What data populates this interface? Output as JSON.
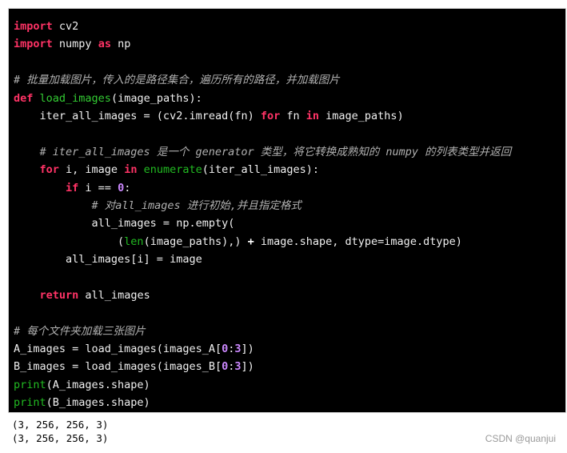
{
  "code": {
    "lines": [
      [
        {
          "t": "import",
          "c": "kw"
        },
        {
          "t": " cv2",
          "c": "tx"
        }
      ],
      [
        {
          "t": "import",
          "c": "kw"
        },
        {
          "t": " numpy ",
          "c": "tx"
        },
        {
          "t": "as",
          "c": "kw"
        },
        {
          "t": " np",
          "c": "tx"
        }
      ],
      [],
      [
        {
          "t": "# 批量加载图片，传入的是路径集合，遍历所有的路径，并加载图片",
          "c": "cm"
        }
      ],
      [
        {
          "t": "def",
          "c": "kw"
        },
        {
          "t": " ",
          "c": "tx"
        },
        {
          "t": "load_images",
          "c": "fn"
        },
        {
          "t": "(image_paths):",
          "c": "tx"
        }
      ],
      [
        {
          "t": "    iter_all_images = (cv2.imread(fn) ",
          "c": "tx"
        },
        {
          "t": "for",
          "c": "kw"
        },
        {
          "t": " fn ",
          "c": "tx"
        },
        {
          "t": "in",
          "c": "kw"
        },
        {
          "t": " image_paths)",
          "c": "tx"
        }
      ],
      [],
      [
        {
          "t": "    ",
          "c": "tx"
        },
        {
          "t": "# iter_all_images 是一个 generator 类型，将它转换成熟知的 numpy 的列表类型并返回",
          "c": "cm"
        }
      ],
      [
        {
          "t": "    ",
          "c": "tx"
        },
        {
          "t": "for",
          "c": "kw"
        },
        {
          "t": " i, image ",
          "c": "tx"
        },
        {
          "t": "in",
          "c": "kw"
        },
        {
          "t": " ",
          "c": "tx"
        },
        {
          "t": "enumerate",
          "c": "bi"
        },
        {
          "t": "(iter_all_images):",
          "c": "tx"
        }
      ],
      [
        {
          "t": "        ",
          "c": "tx"
        },
        {
          "t": "if",
          "c": "kw"
        },
        {
          "t": " i == ",
          "c": "tx"
        },
        {
          "t": "0",
          "c": "num"
        },
        {
          "t": ":",
          "c": "tx"
        }
      ],
      [
        {
          "t": "            ",
          "c": "tx"
        },
        {
          "t": "# 对all_images 进行初始,并且指定格式",
          "c": "cm"
        }
      ],
      [
        {
          "t": "            all_images = np.empty(",
          "c": "tx"
        }
      ],
      [
        {
          "t": "                (",
          "c": "tx"
        },
        {
          "t": "len",
          "c": "bi"
        },
        {
          "t": "(image_paths),) ",
          "c": "tx"
        },
        {
          "t": "+",
          "c": "op"
        },
        {
          "t": " image.shape, dtype=image.dtype)",
          "c": "tx"
        }
      ],
      [
        {
          "t": "        all_images[i] = image",
          "c": "tx"
        }
      ],
      [],
      [
        {
          "t": "    ",
          "c": "tx"
        },
        {
          "t": "return",
          "c": "kw"
        },
        {
          "t": " all_images",
          "c": "tx"
        }
      ],
      [],
      [
        {
          "t": "# 每个文件夹加载三张图片",
          "c": "cm"
        }
      ],
      [
        {
          "t": "A_images = load_images(images_A[",
          "c": "tx"
        },
        {
          "t": "0",
          "c": "num"
        },
        {
          "t": ":",
          "c": "tx"
        },
        {
          "t": "3",
          "c": "num"
        },
        {
          "t": "])",
          "c": "tx"
        }
      ],
      [
        {
          "t": "B_images = load_images(images_B[",
          "c": "tx"
        },
        {
          "t": "0",
          "c": "num"
        },
        {
          "t": ":",
          "c": "tx"
        },
        {
          "t": "3",
          "c": "num"
        },
        {
          "t": "])",
          "c": "tx"
        }
      ],
      [
        {
          "t": "print",
          "c": "bi"
        },
        {
          "t": "(A_images.shape)",
          "c": "tx"
        }
      ],
      [
        {
          "t": "print",
          "c": "bi"
        },
        {
          "t": "(B_images.shape)",
          "c": "tx"
        }
      ]
    ]
  },
  "output": {
    "lines": [
      "(3, 256, 256, 3)",
      "(3, 256, 256, 3)"
    ]
  },
  "watermark": "CSDN @quanjui",
  "colors": {
    "background": "#000000",
    "keyword": "#ff3366",
    "function": "#33cc33",
    "number": "#cc88ff",
    "comment": "#b0b0b0",
    "text": "#f0f0f0"
  }
}
